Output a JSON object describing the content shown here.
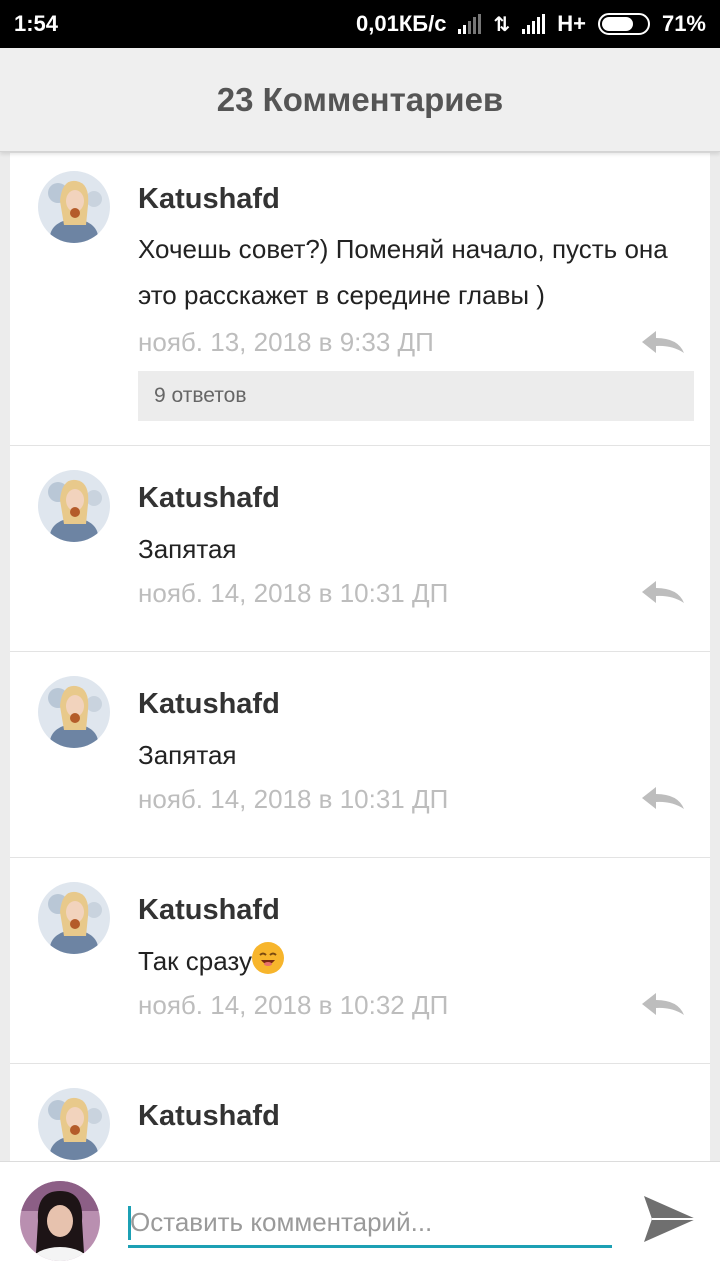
{
  "status_bar": {
    "time": "1:54",
    "network_speed": "0,01КБ/с",
    "network_type": "H+",
    "battery": "71%",
    "battery_level": 0.71
  },
  "header": {
    "title": "23 Комментариев"
  },
  "comments": [
    {
      "author": "Katushafd",
      "text": "Хочешь совет?) Поменяй начало, пусть она это расскажет в середине главы )",
      "date": "нояб. 13, 2018 в 9:33 ДП",
      "replies": "9 ответов"
    },
    {
      "author": "Katushafd",
      "text": "Запятая",
      "date": "нояб. 14, 2018 в 10:31 ДП"
    },
    {
      "author": "Katushafd",
      "text": "Запятая",
      "date": "нояб. 14, 2018 в 10:31 ДП"
    },
    {
      "author": "Katushafd",
      "text": "Так сразу",
      "emoji": "smiling-face-emoji",
      "date": "нояб. 14, 2018 в 10:32 ДП"
    },
    {
      "author": "Katushafd",
      "text": "",
      "date": ""
    }
  ],
  "input_bar": {
    "placeholder": "Оставить комментарий...",
    "value": ""
  },
  "icons": {
    "reply": "reply-icon",
    "send": "send-icon",
    "wifi": "signal-icon",
    "data": "data-arrows-icon",
    "battery": "battery-icon"
  },
  "colors": {
    "accent": "#1ca0b4",
    "header_bg": "#efefef",
    "date_text": "#bdbdbd"
  }
}
